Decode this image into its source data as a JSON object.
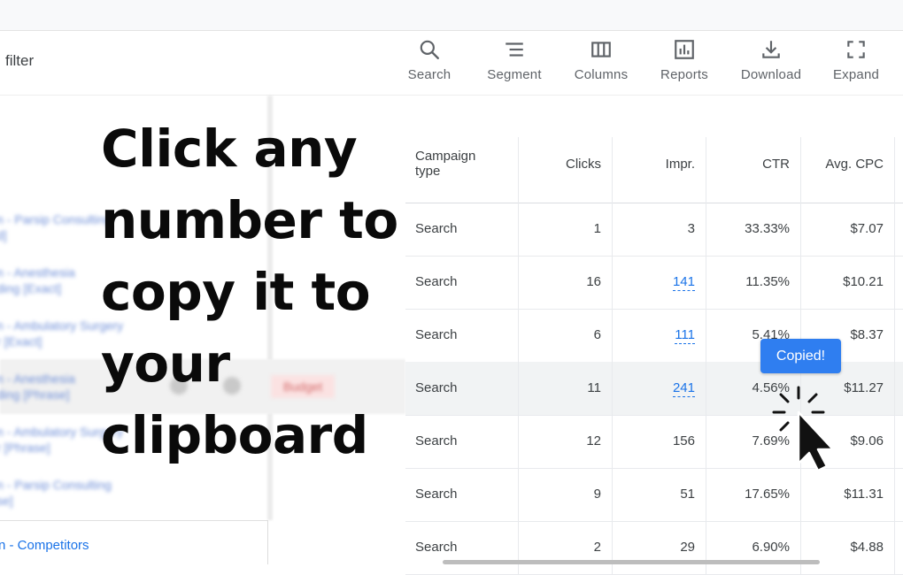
{
  "toolbar": {
    "filter_label": "filter",
    "tools": [
      {
        "label": "Search",
        "icon": "search-icon"
      },
      {
        "label": "Segment",
        "icon": "segment-icon"
      },
      {
        "label": "Columns",
        "icon": "columns-icon"
      },
      {
        "label": "Reports",
        "icon": "reports-icon"
      },
      {
        "label": "Download",
        "icon": "download-icon"
      },
      {
        "label": "Expand",
        "icon": "expand-icon"
      }
    ]
  },
  "headline": {
    "lines": [
      "Click any",
      "number to",
      "copy it to",
      "your",
      "clipboard"
    ]
  },
  "left_rows": [
    {
      "line1": "n - Parsip Consulting",
      "line2": "d]"
    },
    {
      "line1": "n - Anesthesia",
      "line2": "ding [Exact]"
    },
    {
      "line1": "n - Ambulatory Surgery",
      "line2": "r [Exact]"
    },
    {
      "line1": "n - Anesthesia",
      "line2": "ding [Phrase]"
    },
    {
      "line1": "n - Ambulatory Surgery",
      "line2": "r [Phrase]"
    },
    {
      "line1": "n - Parsip Consulting",
      "line2": "se]"
    }
  ],
  "left_budget_label": "Budget",
  "left_link": "n - Competitors",
  "table": {
    "headers": {
      "campaign_type": "Campaign type",
      "clicks": "Clicks",
      "impr": "Impr.",
      "ctr": "CTR",
      "avg_cpc": "Avg. CPC"
    },
    "rows": [
      {
        "type": "Search",
        "clicks": "1",
        "impr": "3",
        "ctr": "33.33%",
        "cpc": "$7.07"
      },
      {
        "type": "Search",
        "clicks": "16",
        "impr": "141",
        "ctr": "11.35%",
        "cpc": "$10.21"
      },
      {
        "type": "Search",
        "clicks": "6",
        "impr": "111",
        "ctr": "5.41%",
        "cpc": "$8.37"
      },
      {
        "type": "Search",
        "clicks": "11",
        "impr": "241",
        "ctr": "4.56%",
        "cpc": "$11.27"
      },
      {
        "type": "Search",
        "clicks": "12",
        "impr": "156",
        "ctr": "7.69%",
        "cpc": "$9.06"
      },
      {
        "type": "Search",
        "clicks": "9",
        "impr": "51",
        "ctr": "17.65%",
        "cpc": "$11.31"
      },
      {
        "type": "Search",
        "clicks": "2",
        "impr": "29",
        "ctr": "6.90%",
        "cpc": "$4.88"
      }
    ]
  },
  "tooltip": {
    "text": "Copied!"
  },
  "colors": {
    "accent": "#1a73e8",
    "tooltip_bg": "#2f7ef0",
    "headline": "#0a0a0a"
  }
}
